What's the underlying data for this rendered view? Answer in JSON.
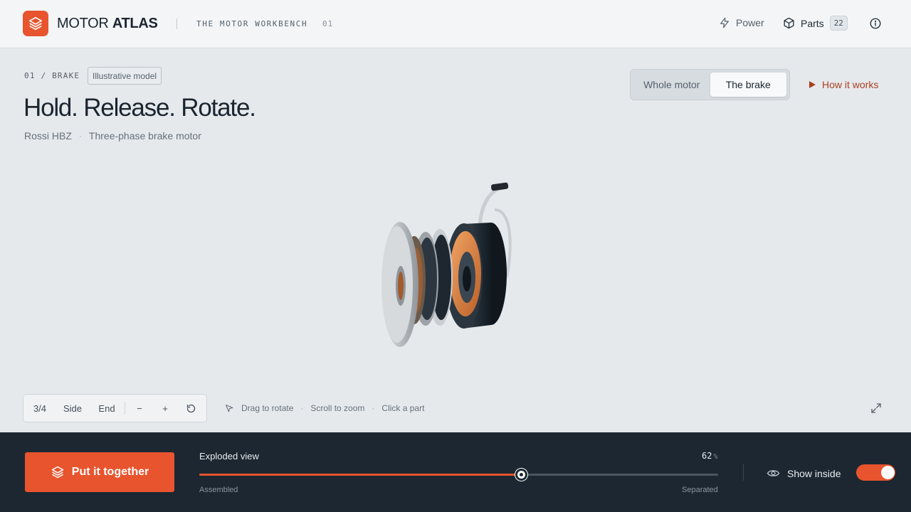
{
  "header": {
    "brand_light": "MOTOR",
    "brand_bold": "ATLAS",
    "workbench": "THE MOTOR WORKBENCH",
    "workbench_num": "01",
    "power_label": "Power",
    "parts_label": "Parts",
    "parts_count": "22",
    "icons": [
      "layers-icon",
      "bolt-icon",
      "cube-icon",
      "info-icon"
    ]
  },
  "hero": {
    "crumb": "01 / BRAKE",
    "badge": "Illustrative model",
    "title": "Hold. Release. Rotate.",
    "model": "Rossi HBZ",
    "type": "Three-phase brake motor"
  },
  "view_toggle": {
    "options": [
      "Whole motor",
      "The brake"
    ],
    "selected": "The brake"
  },
  "how_it_works": "How it works",
  "camera": {
    "views": [
      "3/4",
      "Side",
      "End"
    ],
    "zoom_out": "−",
    "zoom_in": "+"
  },
  "hints": [
    "Drag to rotate",
    "Scroll to zoom",
    "Click a part"
  ],
  "bottom": {
    "cta": "Put it together",
    "slider_label": "Exploded view",
    "slider_value": "62",
    "slider_unit": "%",
    "slider_fraction": 0.62,
    "slider_min_label": "Assembled",
    "slider_max_label": "Separated",
    "show_inside": "Show inside",
    "show_inside_on": true
  },
  "colors": {
    "accent": "#e8542e",
    "bottom_bar": "#1c2731",
    "background": "#e6e9ec"
  }
}
